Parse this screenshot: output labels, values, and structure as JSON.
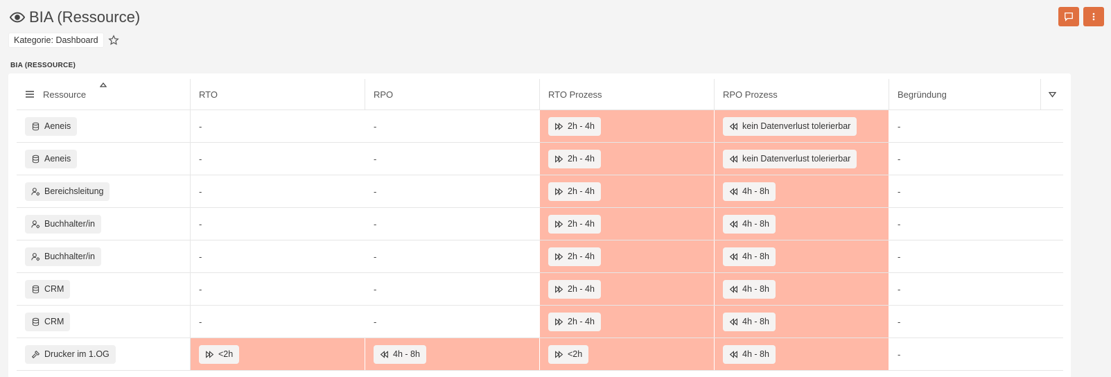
{
  "page": {
    "title": "BIA (Ressource)",
    "category_chip": "Kategorie: Dashboard",
    "section_label": "BIA (RESSOURCE)"
  },
  "colors": {
    "accent": "#e07040",
    "highlight": "#ffb8a6"
  },
  "table": {
    "columns": [
      "Ressource",
      "RTO",
      "RPO",
      "RTO Prozess",
      "RPO Prozess",
      "Begründung"
    ],
    "rows": [
      {
        "resource": "Aeneis",
        "icon": "database-icon",
        "rto": "-",
        "rpo": "-",
        "rto_prozess": "2h - 4h",
        "rpo_prozess": "kein Datenverlust tolerierbar",
        "begruendung": "-"
      },
      {
        "resource": "Aeneis",
        "icon": "database-icon",
        "rto": "-",
        "rpo": "-",
        "rto_prozess": "2h - 4h",
        "rpo_prozess": "kein Datenverlust tolerierbar",
        "begruendung": "-"
      },
      {
        "resource": "Bereichsleitung",
        "icon": "user-gear-icon",
        "rto": "-",
        "rpo": "-",
        "rto_prozess": "2h - 4h",
        "rpo_prozess": "4h - 8h",
        "begruendung": "-"
      },
      {
        "resource": "Buchhalter/in",
        "icon": "user-gear-icon",
        "rto": "-",
        "rpo": "-",
        "rto_prozess": "2h - 4h",
        "rpo_prozess": "4h - 8h",
        "begruendung": "-"
      },
      {
        "resource": "Buchhalter/in",
        "icon": "user-gear-icon",
        "rto": "-",
        "rpo": "-",
        "rto_prozess": "2h - 4h",
        "rpo_prozess": "4h - 8h",
        "begruendung": "-"
      },
      {
        "resource": "CRM",
        "icon": "database-icon",
        "rto": "-",
        "rpo": "-",
        "rto_prozess": "2h - 4h",
        "rpo_prozess": "4h - 8h",
        "begruendung": "-"
      },
      {
        "resource": "CRM",
        "icon": "database-icon",
        "rto": "-",
        "rpo": "-",
        "rto_prozess": "2h - 4h",
        "rpo_prozess": "4h - 8h",
        "begruendung": "-"
      },
      {
        "resource": "Drucker im 1.OG",
        "icon": "hammer-icon",
        "rto": "<2h",
        "rpo": "4h - 8h",
        "rto_prozess": "<2h",
        "rpo_prozess": "4h - 8h",
        "begruendung": "-"
      }
    ]
  }
}
